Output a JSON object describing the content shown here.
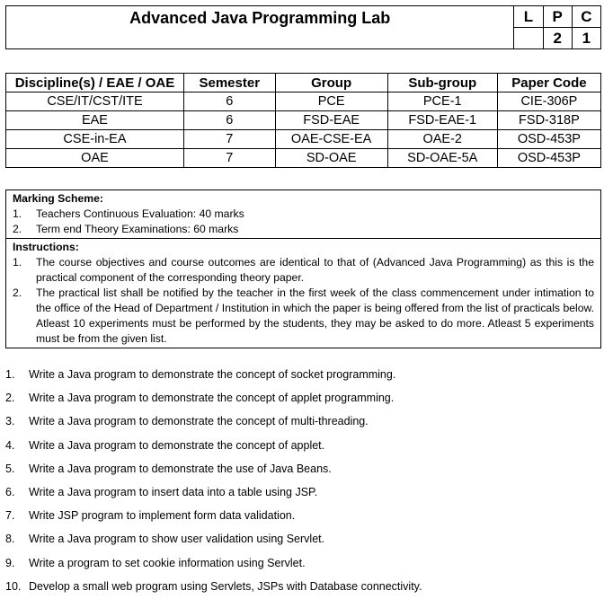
{
  "header": {
    "title": "Advanced Java Programming Lab",
    "credit_labels": [
      "L",
      "P",
      "C"
    ],
    "credit_values": [
      "",
      "2",
      "1"
    ]
  },
  "discipline_table": {
    "columns": [
      "Discipline(s) / EAE / OAE",
      "Semester",
      "Group",
      "Sub-group",
      "Paper Code"
    ],
    "rows": [
      [
        "CSE/IT/CST/ITE",
        "6",
        "PCE",
        "PCE-1",
        "CIE-306P"
      ],
      [
        "EAE",
        "6",
        "FSD-EAE",
        "FSD-EAE-1",
        "FSD-318P"
      ],
      [
        "CSE-in-EA",
        "7",
        "OAE-CSE-EA",
        "OAE-2",
        "OSD-453P"
      ],
      [
        "OAE",
        "7",
        "SD-OAE",
        "SD-OAE-5A",
        "OSD-453P"
      ]
    ]
  },
  "marking_scheme": {
    "heading": "Marking Scheme:",
    "items": [
      {
        "num": "1.",
        "text": "Teachers Continuous Evaluation: 40 marks"
      },
      {
        "num": "2.",
        "text": "Term end Theory Examinations: 60 marks"
      }
    ]
  },
  "instructions": {
    "heading": "Instructions:",
    "items": [
      {
        "num": "1.",
        "text": "The course objectives and course outcomes are identical to that of (Advanced Java Programming) as this is the practical component of the corresponding theory paper."
      },
      {
        "num": "2.",
        "text": "The practical list shall be notified by the teacher in the first week of the class commencement under intimation to the office of the Head of Department / Institution in which the paper is being offered from the list of practicals below. Atleast 10 experiments must be performed by the students, they may be asked to do more. Atleast 5 experiments must be from the given list."
      }
    ]
  },
  "practicals": [
    {
      "num": "1.",
      "text": "Write a Java program to demonstrate the concept of socket programming."
    },
    {
      "num": "2.",
      "text": "Write a Java program to demonstrate the concept of applet programming."
    },
    {
      "num": "3.",
      "text": "Write a Java program to demonstrate the concept of multi-threading."
    },
    {
      "num": "4.",
      "text": "Write a Java program to demonstrate the concept of applet."
    },
    {
      "num": "5.",
      "text": "Write a Java program to demonstrate the use of Java Beans."
    },
    {
      "num": "6.",
      "text": "Write a Java program to insert data into a table using JSP."
    },
    {
      "num": "7.",
      "text": "Write JSP program to implement form data validation."
    },
    {
      "num": "8.",
      "text": "Write a Java program to show user validation using Servlet."
    },
    {
      "num": "9.",
      "text": "Write a program to set cookie information using Servlet."
    },
    {
      "num": "10.",
      "text": "Develop a small web program using Servlets, JSPs with Database connectivity."
    }
  ]
}
